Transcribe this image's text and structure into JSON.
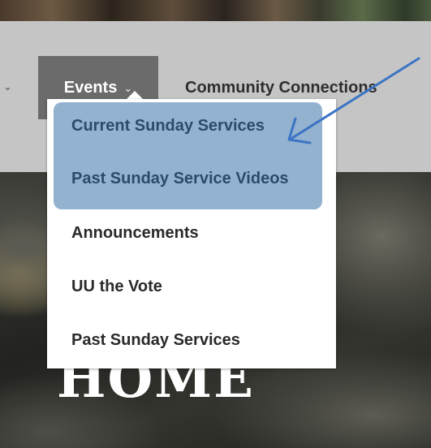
{
  "nav": {
    "left_chevron": "⌄",
    "events_label": "Events",
    "events_chevron": "⌄",
    "community_label": "Community Connections"
  },
  "dropdown": {
    "items": [
      {
        "label": "Current Sunday Services"
      },
      {
        "label": "Past Sunday Service Videos"
      },
      {
        "label": "Announcements"
      },
      {
        "label": "UU the Vote"
      },
      {
        "label": "Past Sunday Services"
      }
    ]
  },
  "hero": {
    "word": "HOME"
  },
  "colors": {
    "nav_bg": "#c5c5c5",
    "active_tab_bg": "#6b6b6b",
    "highlight_bg": "#93b2cf",
    "highlight_text": "#2c4a6c",
    "arrow": "#3b74c4"
  },
  "icons": {
    "left_chevron": "chevron-down-icon",
    "events_chevron": "chevron-down-icon",
    "annotation": "arrow-annotation-icon"
  }
}
